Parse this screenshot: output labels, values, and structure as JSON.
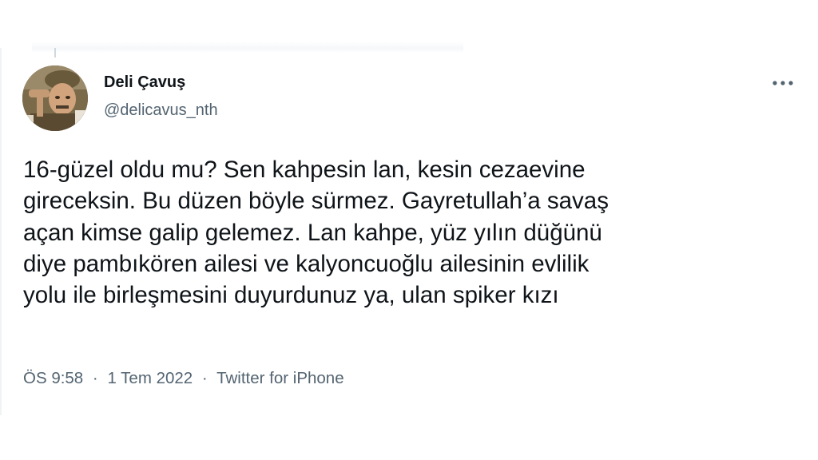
{
  "tweet": {
    "author": {
      "display_name": "Deli Çavuş",
      "handle": "@delicavus_nth"
    },
    "text_lines": [
      "16-güzel oldu mu? Sen kahpesin lan, kesin cezaevine",
      "gireceksin. Bu düzen böyle sürmez. Gayretullah’a savaş",
      "açan kimse galip gelemez. Lan kahpe, yüz yılın düğünü",
      "diye pambıkören ailesi ve kalyoncuoğlu ailesinin evlilik",
      "yolu ile birleşmesini duyurdunuz ya, ulan spiker kızı"
    ],
    "meta": {
      "time": "ÖS 9:58",
      "date": "1 Tem 2022",
      "separator": "·",
      "source": "Twitter for iPhone"
    },
    "more_icon": "more-horizontal-icon"
  },
  "colors": {
    "text_primary": "#0f1419",
    "text_secondary": "#536471"
  }
}
